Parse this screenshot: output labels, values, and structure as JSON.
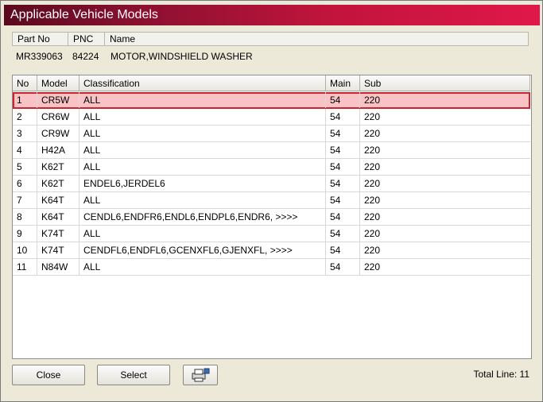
{
  "window": {
    "title": "Applicable Vehicle Models"
  },
  "part_header": {
    "columns": [
      "Part No",
      "PNC",
      "Name"
    ],
    "values": {
      "part_no": "MR339063",
      "pnc": "84224",
      "name": "MOTOR,WINDSHIELD WASHER"
    }
  },
  "grid": {
    "columns": [
      "No",
      "Model",
      "Classification",
      "Main",
      "Sub"
    ],
    "rows": [
      [
        "1",
        "CR5W",
        "ALL",
        "54",
        "220"
      ],
      [
        "2",
        "CR6W",
        "ALL",
        "54",
        "220"
      ],
      [
        "3",
        "CR9W",
        "ALL",
        "54",
        "220"
      ],
      [
        "4",
        "H42A",
        "ALL",
        "54",
        "220"
      ],
      [
        "5",
        "K62T",
        "ALL",
        "54",
        "220"
      ],
      [
        "6",
        "K62T",
        "ENDEL6,JERDEL6",
        "54",
        "220"
      ],
      [
        "7",
        "K64T",
        "ALL",
        "54",
        "220"
      ],
      [
        "8",
        "K64T",
        "CENDL6,ENDFR6,ENDL6,ENDPL6,ENDR6,  >>>>",
        "54",
        "220"
      ],
      [
        "9",
        "K74T",
        "ALL",
        "54",
        "220"
      ],
      [
        "10",
        "K74T",
        "CENDFL6,ENDFL6,GCENXFL6,GJENXFL,  >>>>",
        "54",
        "220"
      ],
      [
        "11",
        "N84W",
        "ALL",
        "54",
        "220"
      ]
    ],
    "selected_row": 0
  },
  "footer": {
    "close_label": "Close",
    "select_label": "Select",
    "print_icon": "printer-icon",
    "total_text": "Total Line: 11"
  },
  "colors": {
    "title_start": "#5a0a1e",
    "title_end": "#e0184a",
    "selection_fill": "#f9c3c6",
    "selection_border": "#c8252f"
  }
}
